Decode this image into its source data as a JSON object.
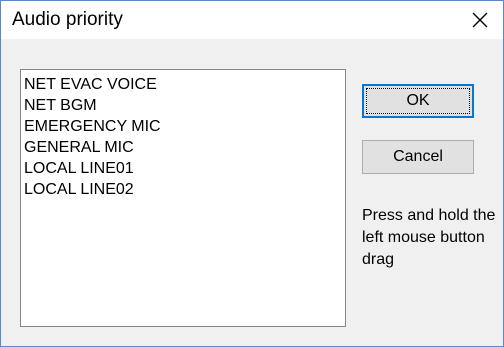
{
  "window": {
    "title": "Audio priority",
    "close_icon": "close-icon"
  },
  "priority_list": {
    "items": [
      {
        "label": "NET EVAC VOICE"
      },
      {
        "label": "NET BGM"
      },
      {
        "label": "EMERGENCY MIC"
      },
      {
        "label": "GENERAL MIC"
      },
      {
        "label": "LOCAL LINE01"
      },
      {
        "label": "LOCAL LINE02"
      }
    ]
  },
  "buttons": {
    "ok_label": "OK",
    "cancel_label": "Cancel"
  },
  "hint": {
    "text": "Press and hold the left mouse button drag"
  },
  "colors": {
    "window_border": "#5b86c7",
    "dialog_background": "#f0f0f0",
    "button_face": "#e1e1e1",
    "default_button_border": "#0078d7"
  }
}
